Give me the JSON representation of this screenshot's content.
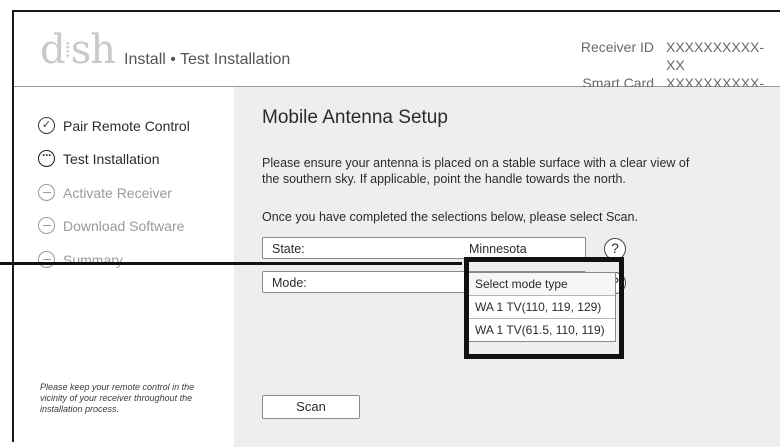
{
  "header": {
    "logo_text": "dish",
    "breadcrumb": "Install • Test Installation",
    "receiver_id_label": "Receiver ID",
    "receiver_id_value": "XXXXXXXXXX-XX",
    "smart_card_label": "Smart Card ID",
    "smart_card_value": "XXXXXXXXXX-XX"
  },
  "sidebar": {
    "steps": [
      {
        "label": "Pair Remote Control",
        "status": "done"
      },
      {
        "label": "Test Installation",
        "status": "current"
      },
      {
        "label": "Activate Receiver",
        "status": "pending"
      },
      {
        "label": "Download Software",
        "status": "pending"
      },
      {
        "label": "Summary",
        "status": "pending"
      }
    ],
    "note": "Please keep your remote control in the vicinity of your receiver throughout the installation process."
  },
  "main": {
    "title": "Mobile Antenna Setup",
    "description": "Please ensure your antenna is placed on a stable surface with a clear view of the southern sky.  If applicable, point the handle towards the north.",
    "instruction": "Once you have completed the selections below, please select Scan.",
    "state_label": "State:",
    "state_value": "Minnesota",
    "mode_label": "Mode:",
    "help_glyph": "?",
    "dropdown_header": "Select mode type",
    "mode_options": [
      "WA 1 TV(110, 119, 129)",
      "WA 1 TV(61.5, 110, 119)"
    ],
    "scan_label": "Scan"
  }
}
